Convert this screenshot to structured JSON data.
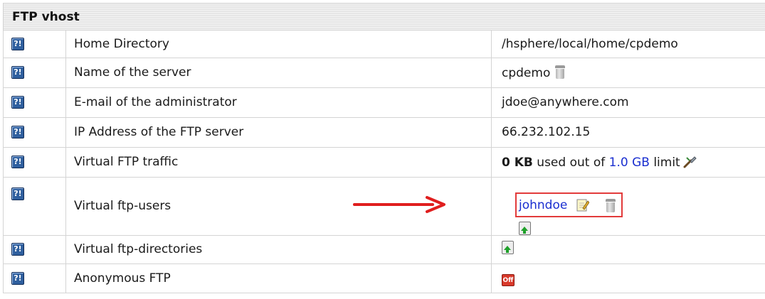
{
  "panel": {
    "title": "FTP vhost",
    "help_icon_glyph": "?!"
  },
  "rows": [
    {
      "label": "Home Directory",
      "value": "/hsphere/local/home/cpdemo"
    },
    {
      "label": "Name of the server",
      "value": "cpdemo",
      "icon": "trash-icon"
    },
    {
      "label": "E-mail of the administrator",
      "value": "jdoe@anywhere.com"
    },
    {
      "label": "IP Address of the FTP server",
      "value": "66.232.102.15"
    },
    {
      "label": "Virtual FTP traffic",
      "traffic": {
        "used": "0 KB",
        "used_out_of": "used out of",
        "limit": "1.0 GB",
        "limit_suffix": "limit"
      },
      "icon": "wrench-icon"
    },
    {
      "label": "Virtual ftp-users",
      "users": [
        "johndoe"
      ],
      "icons": [
        "edit-icon",
        "trash-icon",
        "add-icon"
      ],
      "annotation": {
        "arrow_color": "#e01e1e",
        "box_color": "#e23b3b"
      }
    },
    {
      "label": "Virtual ftp-directories",
      "icon": "add-icon"
    },
    {
      "label": "Anonymous FTP",
      "status": "Off",
      "icon": "off-icon"
    }
  ],
  "colors": {
    "link": "#1a2fd0",
    "header_bg": "#e6e6e6",
    "grid": "#d4d4d4"
  }
}
